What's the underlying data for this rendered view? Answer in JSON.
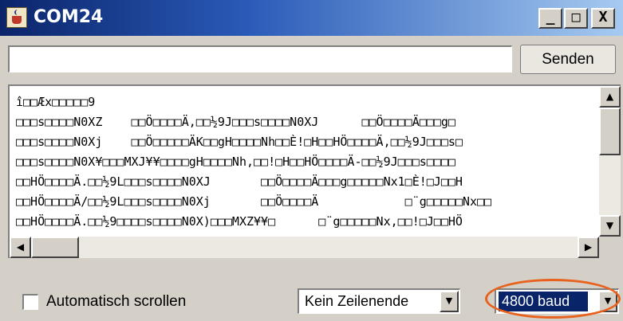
{
  "window": {
    "title": "COM24",
    "controls": {
      "minimize": "_",
      "maximize": "□",
      "close": "X"
    }
  },
  "send": {
    "input_value": "",
    "button_label": "Senden"
  },
  "output": {
    "lines": [
      "î□□Æx□□□□□9",
      "□□□s□□□□N0XZ    □□Ö□□□□Ä,□□½9J□□□s□□□□N0XJ      □□Ö□□□□Ä□□□g□",
      "□□□s□□□□N0Xj    □□Ö□□□□□ÄK□□gH□□□□Nh□□È!□H□□HÖ□□□□Ä,□□½9J□□□s□",
      "□□□s□□□□N0X¥□□□MXJ¥¥□□□□gH□□□□Nh,□□!□H□□HÖ□□□□Ä-□□½9J□□□s□□□□",
      "□□HÖ□□□□Ä.□□½9L□□□s□□□□N0XJ       □□Ö□□□□Ä□□□g□□□□□Nx1□È!□J□□H",
      "□□HÖ□□□□Ä/□□½9L□□□s□□□□N0Xj       □□Ö□□□□Ä            □¨g□□□□□Nx□□",
      "□□HÖ□□□□Ä.□□½9□□□□s□□□□N0X)□□□MXZ¥¥□      □¨g□□□□□Nx,□□!□J□□HÖ"
    ]
  },
  "bottom": {
    "autoscroll_label": "Automatisch scrollen",
    "autoscroll_checked": false,
    "line_ending_value": "Kein Zeilenende",
    "baud_value": "4800 baud"
  },
  "icons": {
    "app": "java-icon",
    "dropdown": "chevron-down-icon",
    "scroll_up": "arrow-up-icon",
    "scroll_down": "arrow-down-icon",
    "scroll_left": "arrow-left-icon",
    "scroll_right": "arrow-right-icon"
  },
  "colors": {
    "titlebar_start": "#0b246a",
    "titlebar_end": "#a6caf0",
    "selection": "#0a246a",
    "highlight_ring": "#e8621d",
    "window_face": "#d4d0c8"
  }
}
